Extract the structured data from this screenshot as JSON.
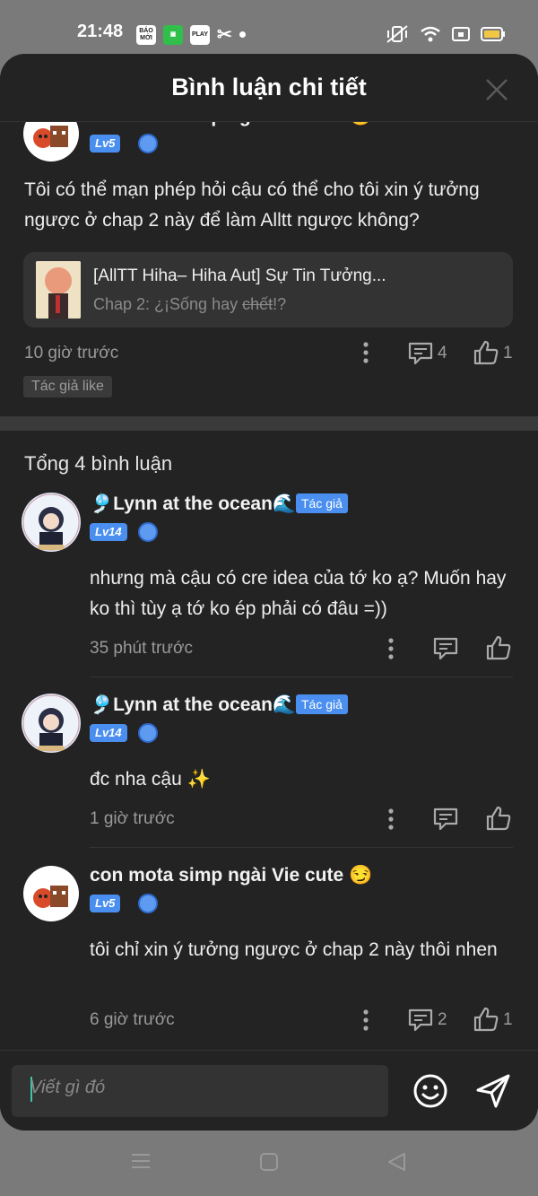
{
  "status": {
    "time": "21:48",
    "apps": [
      "BÁO MỚI",
      "",
      "PLAY",
      ""
    ]
  },
  "header": {
    "title": "Bình luận chi tiết"
  },
  "top_comment": {
    "username": "con mota simp ngài Vie cute 😏",
    "level": "Lv5",
    "text": "Tôi có thể mạn phép hỏi cậu có thể cho tôi xin ý tưởng ngược ở chap 2 này để làm Alltt ngược không?",
    "link": {
      "title": "[AllTT Hiha– Hiha Aut] Sự Tin Tưởng...",
      "chapter_prefix": "Chap 2: ¿¡Sống hay ",
      "chapter_strike": "chết",
      "chapter_suffix": "!?"
    },
    "time": "10 giờ trước",
    "reply_count": "4",
    "like_count": "1",
    "author_like": "Tác giả like"
  },
  "total_label": "Tổng 4 bình luận",
  "replies": [
    {
      "username": "🎐Lynn at the ocean🌊",
      "tag": "Tác giả",
      "level": "Lv14",
      "text": "nhưng mà cậu có cre idea của tớ ko ạ? Muốn hay ko thì tùy ạ tớ ko ép phải có đâu =))",
      "time": "35 phút trước"
    },
    {
      "username": "🎐Lynn at the ocean🌊",
      "tag": "Tác giả",
      "level": "Lv14",
      "text": "đc nha cậu ✨",
      "time": "1 giờ trước"
    },
    {
      "username": "con mota simp ngài Vie cute 😏",
      "level": "Lv5",
      "text": "tôi chỉ xin ý tưởng ngược ở chap 2 này thôi nhen",
      "time": "6 giờ trước",
      "reply_count": "2",
      "like_count": "1"
    }
  ],
  "input": {
    "placeholder": "Viết gì đó"
  },
  "colors": {
    "background": "#232323",
    "accent": "#4a8ff0",
    "caret": "#3ec7a8"
  },
  "icons": [
    "close-icon",
    "more-icon",
    "comment-icon",
    "like-icon",
    "emoji-icon",
    "send-icon",
    "gem-icon",
    "menu-icon",
    "home-icon",
    "back-icon"
  ]
}
